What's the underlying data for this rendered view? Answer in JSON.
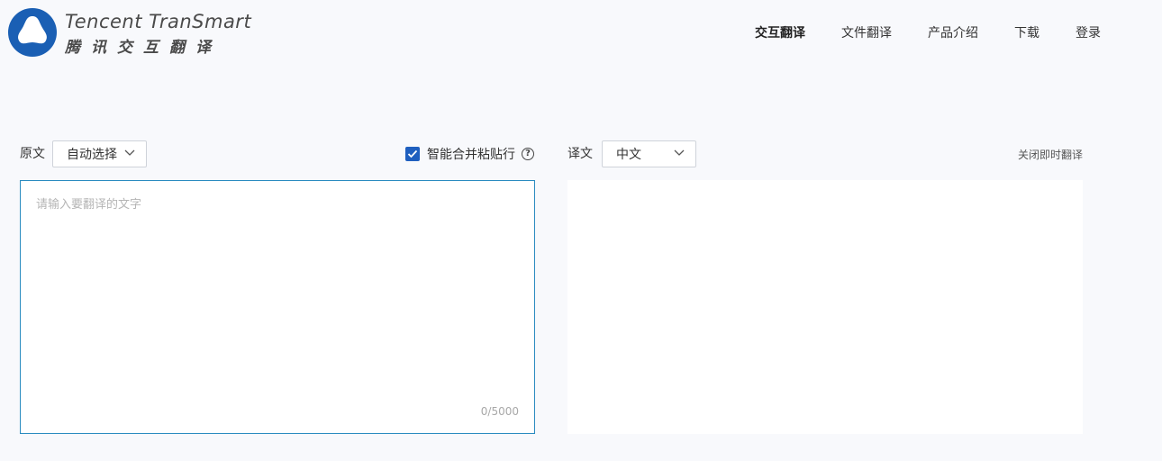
{
  "brand": {
    "name_en": "Tencent TranSmart",
    "name_cn": "腾讯交互翻译",
    "logo_icon": "tencent-transmart-logo",
    "logo_color": "#1a5fb4"
  },
  "nav": {
    "items": [
      {
        "label": "交互翻译",
        "active": true
      },
      {
        "label": "文件翻译",
        "active": false
      },
      {
        "label": "产品介绍",
        "active": false
      },
      {
        "label": "下载",
        "active": false
      },
      {
        "label": "登录",
        "active": false
      }
    ]
  },
  "source": {
    "label": "原文",
    "language": "自动选择",
    "merge_option": {
      "label": "智能合并粘贴行",
      "checked": true,
      "help_icon": "question-circle-icon"
    },
    "placeholder": "请输入要翻译的文字",
    "value": "",
    "counter": "0/5000"
  },
  "target": {
    "label": "译文",
    "language": "中文",
    "close_instant": "关闭即时翻译",
    "value": ""
  },
  "colors": {
    "background": "#f8f9fc",
    "accent": "#1f5fbf",
    "focus_border": "#2a8bc0"
  }
}
